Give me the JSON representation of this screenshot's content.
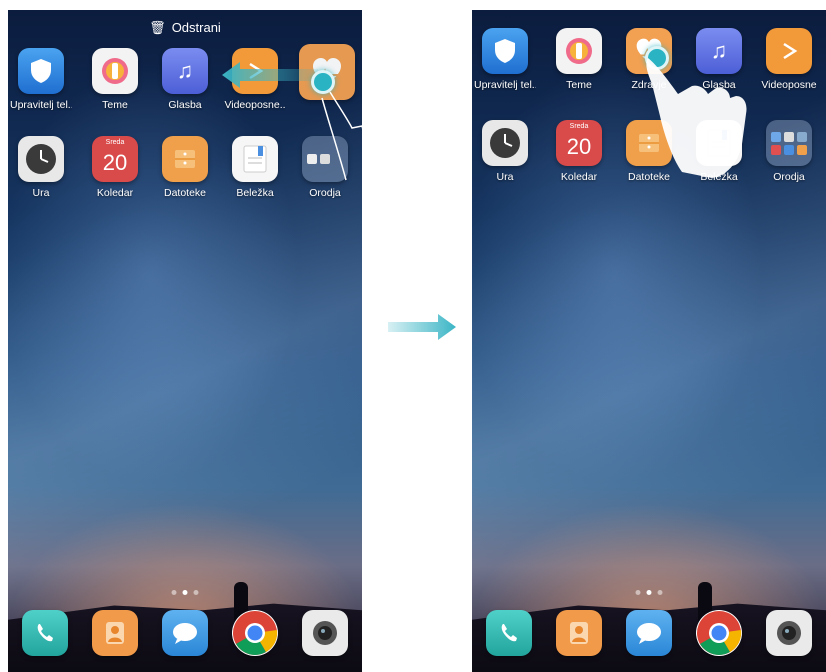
{
  "left_screen": {
    "topbar": {
      "label": "Odstrani"
    },
    "row1": [
      {
        "label": "Upravitelj tel..",
        "icon": "shield-icon"
      },
      {
        "label": "Teme",
        "icon": "brush-icon"
      },
      {
        "label": "Glasba",
        "icon": "music-note-icon"
      },
      {
        "label": "Videoposne..",
        "icon": "play-icon"
      }
    ],
    "dragged_app": {
      "icon": "heart-icon"
    },
    "row2": [
      {
        "label": "Ura",
        "icon": "clock-icon"
      },
      {
        "label": "Koledar",
        "icon": "calendar-icon",
        "weekday": "Sreda",
        "day": "20"
      },
      {
        "label": "Datoteke",
        "icon": "folder-icon"
      },
      {
        "label": "Beležka",
        "icon": "notepad-icon"
      },
      {
        "label": "Orodja",
        "icon": "app-folder-icon"
      }
    ]
  },
  "right_screen": {
    "row1": [
      {
        "label": "Upravitelj tel..",
        "icon": "shield-icon"
      },
      {
        "label": "Teme",
        "icon": "brush-icon"
      },
      {
        "label": "Zdravje",
        "icon": "heart-icon"
      },
      {
        "label": "Glasba",
        "icon": "music-note-icon"
      },
      {
        "label": "Videoposne",
        "icon": "play-icon"
      }
    ],
    "row2": [
      {
        "label": "Ura",
        "icon": "clock-icon"
      },
      {
        "label": "Koledar",
        "icon": "calendar-icon",
        "weekday": "Sreda",
        "day": "20"
      },
      {
        "label": "Datoteke",
        "icon": "folder-icon"
      },
      {
        "label": "Beležka",
        "icon": "notepad-icon"
      },
      {
        "label": "Orodja",
        "icon": "app-folder-icon"
      }
    ]
  },
  "dock": [
    {
      "icon": "phone-icon"
    },
    {
      "icon": "contacts-icon"
    },
    {
      "icon": "messages-icon"
    },
    {
      "icon": "chrome-icon"
    },
    {
      "icon": "camera-icon"
    }
  ],
  "colors": {
    "accent": "#2ab3c2",
    "arrow": "#3bb5c5"
  }
}
